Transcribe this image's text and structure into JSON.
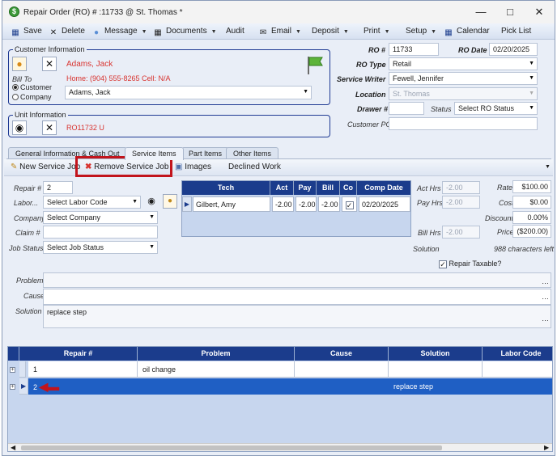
{
  "window": {
    "title": "Repair Order (RO) # :11733 @ St. Thomas *",
    "app_icon_glyph": "$"
  },
  "toolbar": {
    "save": "Save",
    "delete": "Delete",
    "message": "Message",
    "documents": "Documents",
    "audit": "Audit",
    "email": "Email",
    "deposit": "Deposit",
    "print": "Print",
    "setup": "Setup",
    "calendar": "Calendar",
    "picklist": "Pick List"
  },
  "customer": {
    "group_title": "Customer Information",
    "name": "Adams, Jack",
    "phones": "Home: (904) 555-8265 Cell: N/A",
    "bill_to_label": "Bill To",
    "radio_customer": "Customer",
    "radio_company": "Company",
    "bill_to_value": "Adams, Jack"
  },
  "unit": {
    "group_title": "Unit Information",
    "value": "RO11732 U"
  },
  "ro": {
    "ro_no_label": "RO #",
    "ro_no": "11733",
    "ro_date_label": "RO Date",
    "ro_date": "02/20/2025",
    "ro_type_label": "RO Type",
    "ro_type": "Retail",
    "writer_label": "Service Writer",
    "writer": "Fewell, Jennifer",
    "location_label": "Location",
    "location": "St. Thomas",
    "drawer_label": "Drawer #",
    "drawer": "",
    "status_label": "Status",
    "status": "Select RO Status",
    "customer_po_label": "Customer PO",
    "customer_po": ""
  },
  "tabs": [
    "General Information & Cash Out",
    "Service Items",
    "Part Items",
    "Other Items"
  ],
  "subtoolbar": {
    "new_job": "New Service Job",
    "remove_job": "Remove Service Job",
    "images": "Images",
    "declined": "Declined Work"
  },
  "job": {
    "repair_label": "Repair #",
    "repair_no": "2",
    "labor_label": "Labor...",
    "labor_code": "Select Labor Code",
    "company_label": "Company",
    "company": "Select Company",
    "claim_label": "Claim #",
    "claim": "",
    "job_status_label": "Job Status",
    "job_status": "Select Job Status",
    "act_hrs_label": "Act Hrs",
    "act_hrs": "-2.00",
    "pay_hrs_label": "Pay Hrs",
    "pay_hrs": "-2.00",
    "bill_hrs_label": "Bill Hrs",
    "bill_hrs": "-2.00",
    "rate_label": "Rate",
    "rate": "$100.00",
    "cost_label": "Cost",
    "cost": "$0.00",
    "discount_label": "Discount",
    "discount": "0.00%",
    "price_label": "Price",
    "price": "($200.00)",
    "solution_hint_label": "Solution",
    "chars_left": "988 characters left",
    "repair_taxable": "Repair Taxable?",
    "problem_label": "Problem",
    "problem": "",
    "cause_label": "Cause",
    "cause": "",
    "solution_label": "Solution",
    "solution": "replace step"
  },
  "tech_table": {
    "headers": [
      "Tech",
      "Act",
      "Pay",
      "Bill",
      "Co",
      "Comp Date"
    ],
    "row": {
      "tech": "Gilbert, Amy",
      "act": "-2.00",
      "pay": "-2.00",
      "bill": "-2.00",
      "co": "✓",
      "comp_date": "02/20/2025"
    }
  },
  "grid": {
    "headers": [
      "Repair #",
      "Problem",
      "Cause",
      "Solution",
      "Labor Code"
    ],
    "rows": [
      {
        "repair": "1",
        "problem": "oil change",
        "cause": "",
        "solution": "",
        "labor": ""
      },
      {
        "repair": "2",
        "problem": "",
        "cause": "",
        "solution": "replace step",
        "labor": ""
      }
    ]
  },
  "colors": {
    "header_blue": "#1b3c8c",
    "selected_row": "#1f5fc4",
    "highlight_red": "#c2141c",
    "name_red": "#d8332f"
  }
}
